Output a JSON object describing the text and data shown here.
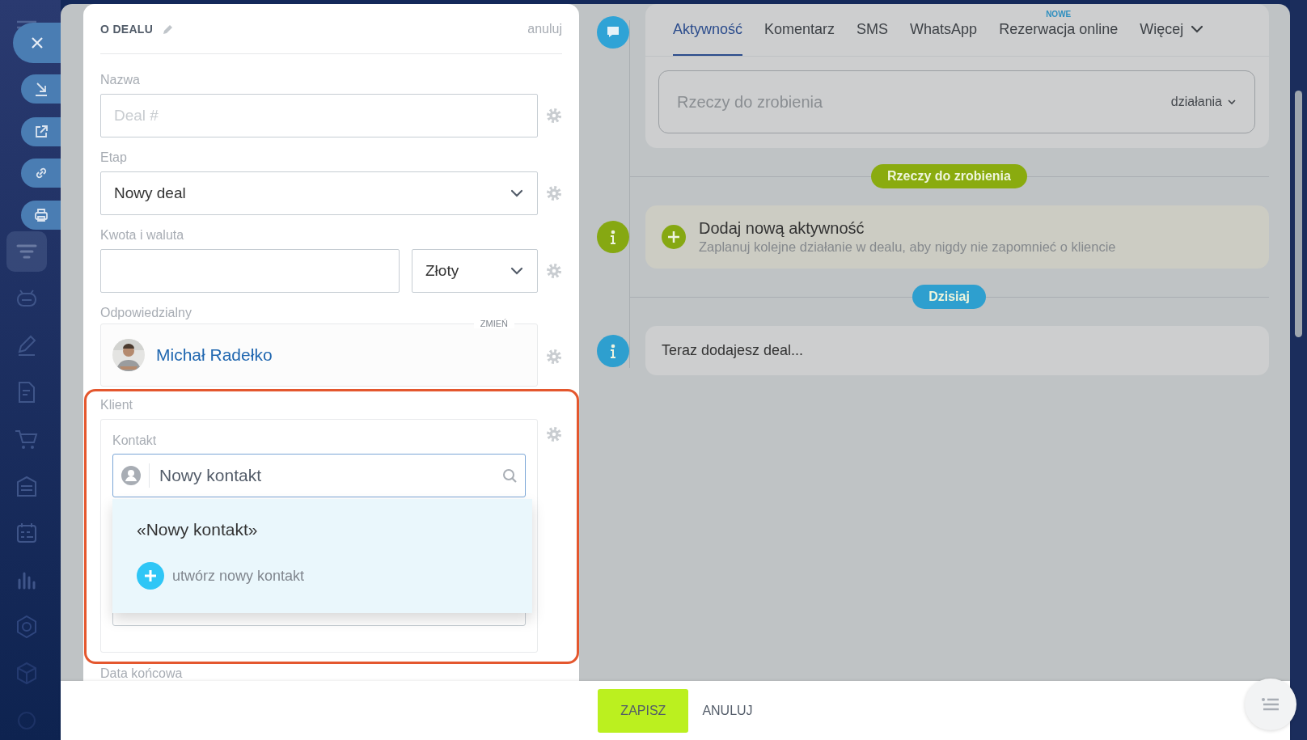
{
  "sidebar": {
    "items": [
      {
        "kind": "menu",
        "selected": false
      },
      {
        "kind": "funnel",
        "selected": true
      },
      {
        "kind": "robot",
        "selected": false
      },
      {
        "kind": "pencil",
        "selected": false
      },
      {
        "kind": "document",
        "selected": false
      },
      {
        "kind": "cart",
        "selected": false
      },
      {
        "kind": "warehouse",
        "selected": false
      },
      {
        "kind": "calendar",
        "selected": false
      },
      {
        "kind": "chart",
        "selected": false
      },
      {
        "kind": "hexagon",
        "selected": false
      },
      {
        "kind": "cube",
        "selected": false
      },
      {
        "kind": "circle",
        "selected": false
      }
    ]
  },
  "form": {
    "title": "O DEALU",
    "cancel_link": "anuluj",
    "fields": [
      {
        "kind": "text",
        "label": "Nazwa",
        "placeholder": "Deal #"
      },
      {
        "kind": "select",
        "label": "Etap",
        "value": "Nowy deal"
      },
      {
        "kind": "money",
        "label": "Kwota i waluta",
        "currency": "Złoty"
      },
      {
        "kind": "user",
        "label": "Odpowiedzialny",
        "action": "ZMIEŃ",
        "name": "Michał Radełko"
      },
      {
        "kind": "client",
        "label": "Klient",
        "highlighted": true,
        "contact": {
          "label": "Kontakt",
          "value": "Nowy kontakt",
          "suggestions": [
            {
              "kind": "match",
              "text": "«Nowy kontakt»"
            },
            {
              "kind": "create",
              "text": "utwórz nowy kontakt"
            }
          ]
        }
      },
      {
        "kind": "date",
        "label": "Data końcowa"
      }
    ]
  },
  "timeline": {
    "tabs": [
      {
        "label": "Aktywność",
        "selected": true
      },
      {
        "label": "Komentarz",
        "selected": false
      },
      {
        "label": "SMS",
        "selected": false
      },
      {
        "label": "WhatsApp",
        "selected": false
      },
      {
        "label": "Rezerwacja online",
        "selected": false,
        "badge": "NOWE"
      },
      {
        "label": "Więcej",
        "selected": false,
        "dropdown": true
      }
    ],
    "composer": {
      "placeholder": "Rzeczy do zrobienia",
      "menu": "działania"
    },
    "entries": [
      {
        "kind": "badge",
        "text": "Rzeczy do zrobienia",
        "color": "#8aab0f"
      },
      {
        "kind": "action",
        "color": "#86a812",
        "title": "Dodaj nową aktywność",
        "text": "Zaplanuj kolejne działanie w dealu, aby nigdy nie zapomnieć o kliencie"
      },
      {
        "kind": "badge",
        "text": "Dzisiaj",
        "color": "#2e9fcf"
      },
      {
        "kind": "info",
        "color": "#2e9fcf",
        "text": "Teraz dodajesz deal..."
      }
    ]
  },
  "footer": {
    "buttons": [
      {
        "kind": "primary",
        "label": "ZAPISZ"
      },
      {
        "kind": "link",
        "label": "ANULUJ"
      }
    ]
  }
}
